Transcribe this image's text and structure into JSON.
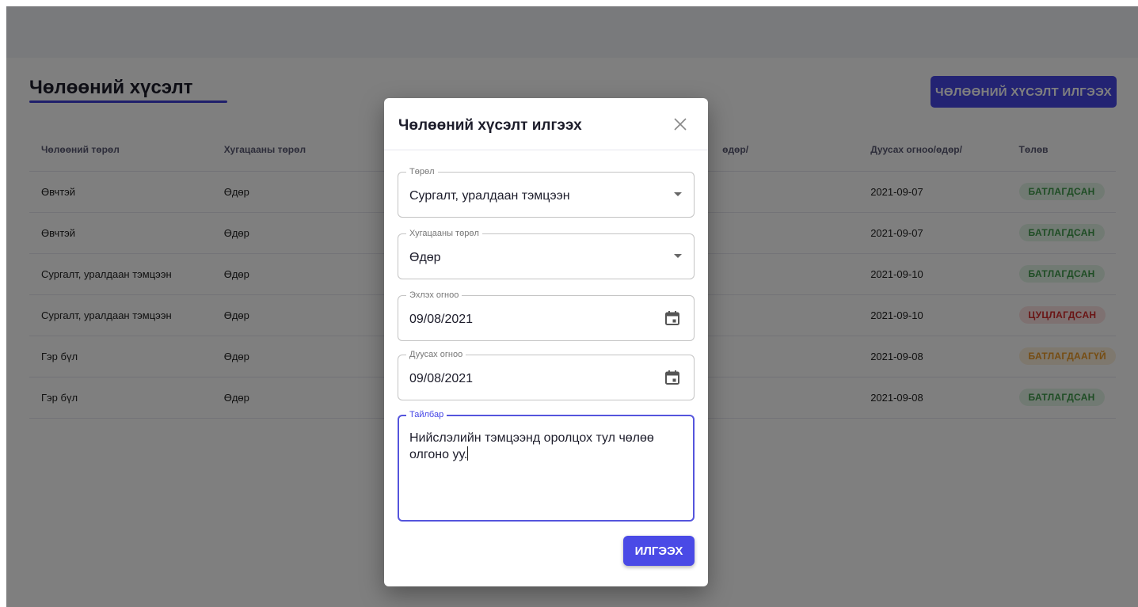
{
  "page": {
    "title": "Чөлөөний хүсэлт",
    "new_request_button": "ЧӨЛӨӨНИЙ ХҮСЭЛТ ИЛГЭЭХ"
  },
  "table": {
    "headers": [
      "Чөлөөний төрөл",
      "Хугацааны төрөл",
      "",
      "өдөр/",
      "Дуусах огноо/өдөр/",
      "Төлөв"
    ],
    "rows": [
      {
        "type": "Өвчтэй",
        "period": "Өдөр",
        "end": "2021-09-07",
        "status": "БАТЛАГДСАН",
        "status_color": "green"
      },
      {
        "type": "Өвчтэй",
        "period": "Өдөр",
        "end": "2021-09-07",
        "status": "БАТЛАГДСАН",
        "status_color": "green"
      },
      {
        "type": "Сургалт, уралдаан тэмцээн",
        "period": "Өдөр",
        "end": "2021-09-10",
        "status": "БАТЛАГДСАН",
        "status_color": "green"
      },
      {
        "type": "Сургалт, уралдаан тэмцээн",
        "period": "Өдөр",
        "end": "2021-09-10",
        "status": "ЦУЦЛАГДСАН",
        "status_color": "red"
      },
      {
        "type": "Гэр бүл",
        "period": "Өдөр",
        "end": "2021-09-08",
        "status": "БАТЛАГДААГҮЙ",
        "status_color": "orange"
      },
      {
        "type": "Гэр бүл",
        "period": "Өдөр",
        "end": "2021-09-08",
        "status": "БАТЛАГДСАН",
        "status_color": "green"
      }
    ]
  },
  "modal": {
    "title": "Чөлөөний хүсэлт илгээх",
    "close_icon": "close-icon",
    "fields": {
      "type": {
        "label": "Төрөл",
        "value": "Сургалт, уралдаан тэмцээн"
      },
      "period": {
        "label": "Хугацааны төрөл",
        "value": "Өдөр"
      },
      "start_date": {
        "label": "Эхлэх огноо",
        "value": "09/08/2021"
      },
      "end_date": {
        "label": "Дуусах огноо",
        "value": "09/08/2021"
      },
      "description": {
        "label": "Тайлбар",
        "value": "Нийслэлийн тэмцээнд оролцох тул чөлөө олгоно уу."
      }
    },
    "submit_button": "ИЛГЭЭХ"
  },
  "colors": {
    "accent": "#4646e6",
    "status_green": "#3e9a4a",
    "status_red": "#d42b2b",
    "status_orange": "#ec9a26"
  }
}
